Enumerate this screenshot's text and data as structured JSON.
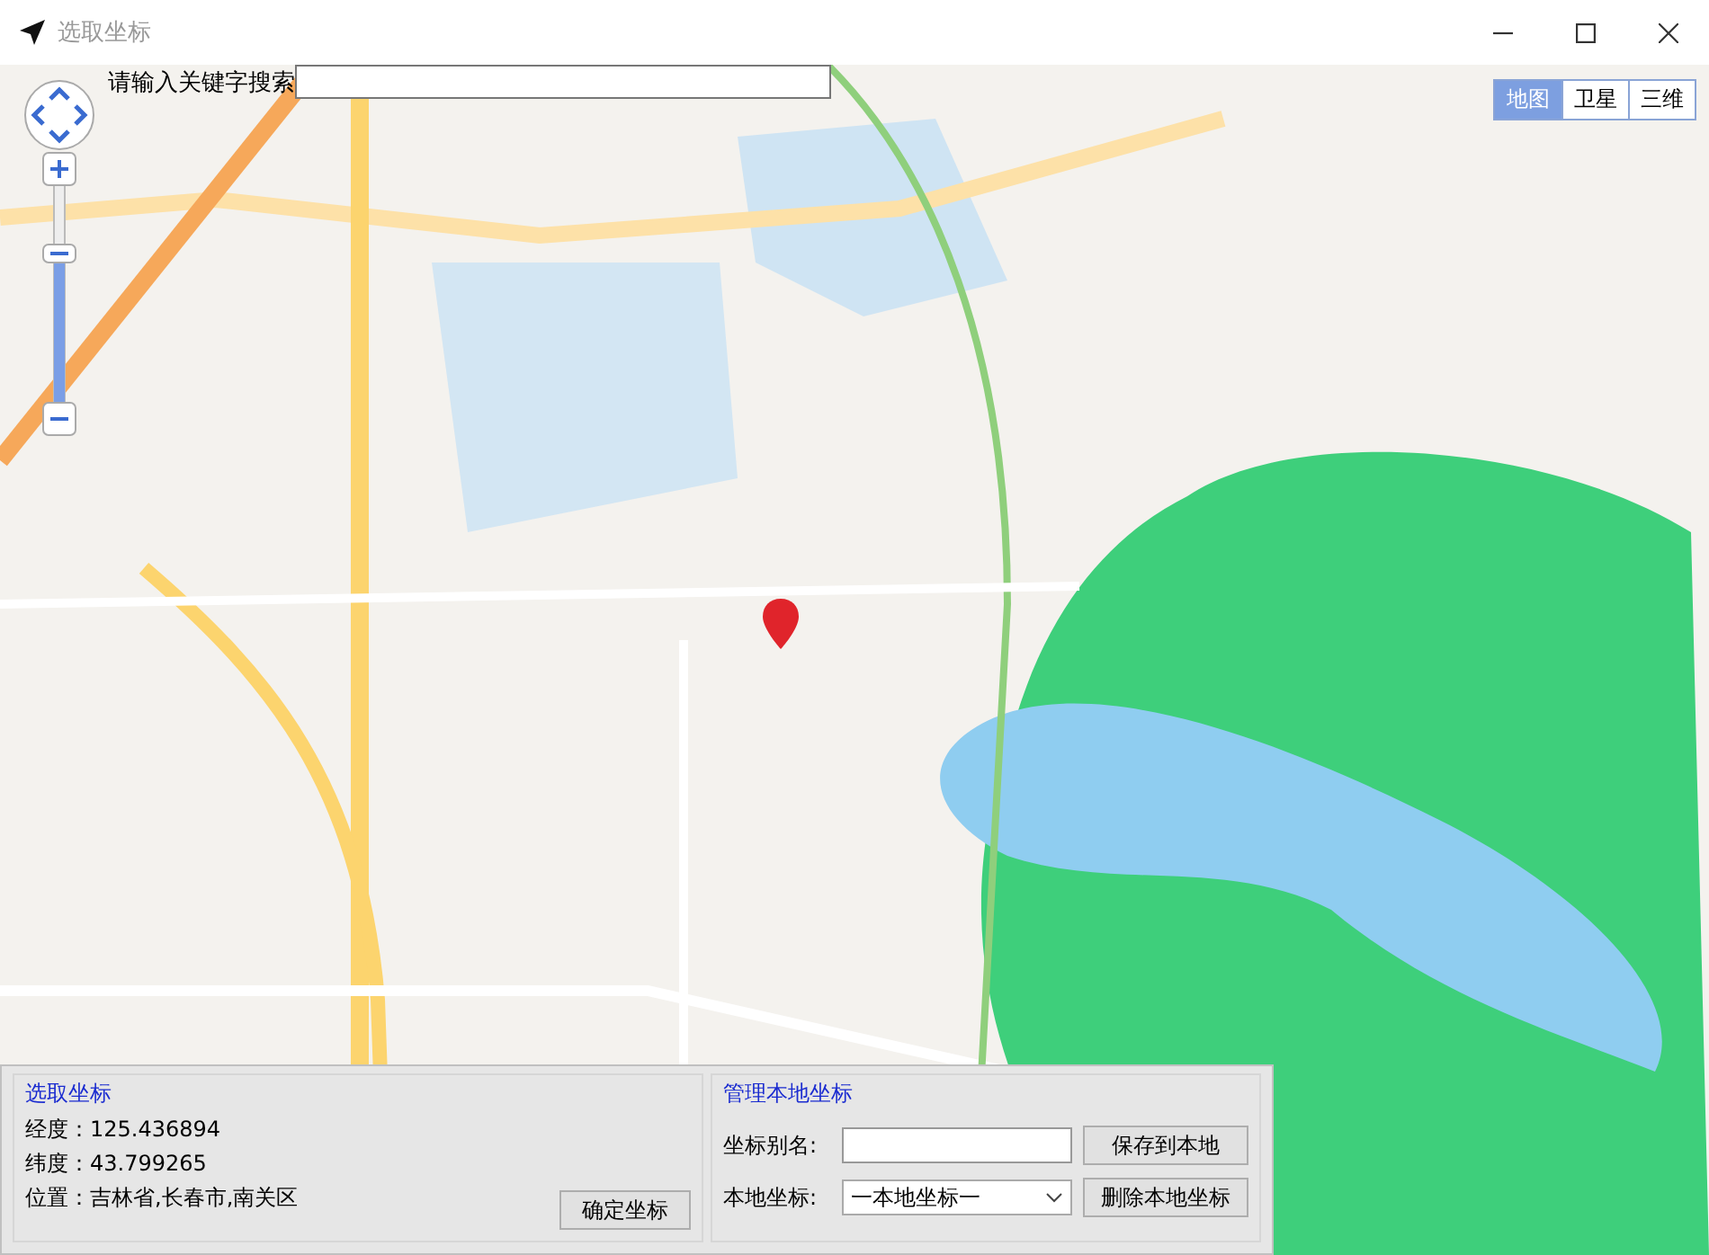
{
  "window": {
    "title": "选取坐标"
  },
  "search": {
    "label": "请输入关键字搜索"
  },
  "map_types": [
    {
      "label": "地图",
      "selected": true
    },
    {
      "label": "卫星",
      "selected": false
    },
    {
      "label": "三维",
      "selected": false
    }
  ],
  "pick_panel": {
    "title": "选取坐标",
    "fields": [
      {
        "label": "经度：",
        "value": "125.436894"
      },
      {
        "label": "纬度：",
        "value": "43.799265"
      },
      {
        "label": "位置：",
        "value": "吉林省,长春市,南关区"
      }
    ],
    "confirm_button": "确定坐标"
  },
  "local_panel": {
    "title": "管理本地坐标",
    "alias_label": "坐标别名:",
    "save_button": "保存到本地",
    "local_label": "本地坐标:",
    "local_select": "一本地坐标一",
    "delete_button": "删除本地坐标"
  }
}
